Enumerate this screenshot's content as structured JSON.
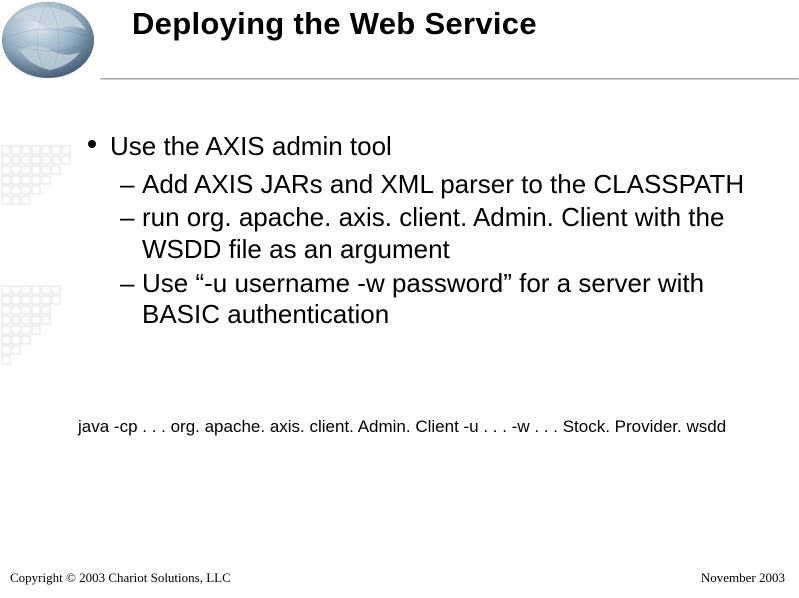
{
  "title": "Deploying the Web Service",
  "bullets": {
    "l1": "Use the AXIS admin tool",
    "l2": [
      "Add AXIS JARs and XML parser to the CLASSPATH",
      "run org. apache. axis. client. Admin. Client with the WSDD file as an argument",
      "Use “-u username -w password” for a server with BASIC authentication"
    ]
  },
  "command": "java -cp . . . org. apache. axis. client. Admin. Client -u . . . -w . . . Stock. Provider. wsdd",
  "footer": {
    "left": "Copyright © 2003 Chariot Solutions, LLC",
    "right": "November 2003"
  }
}
